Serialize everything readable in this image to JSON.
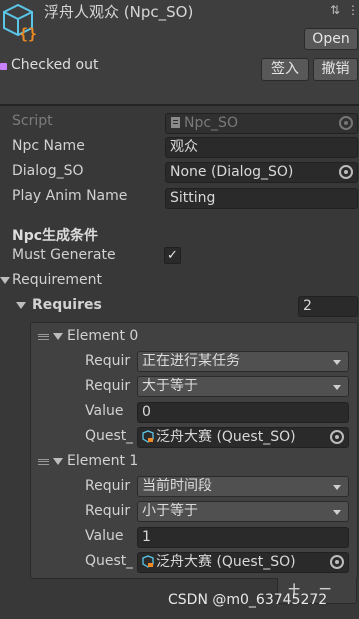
{
  "header": {
    "title": "浮舟人观众 (Npc_SO)",
    "open_button": "Open",
    "checked_out": "Checked out",
    "checkin_button": "签入",
    "undo_button": "撤销"
  },
  "fields": {
    "script_label": "Script",
    "script_value": "Npc_SO",
    "npc_name_label": "Npc Name",
    "npc_name_value": "观众",
    "dialog_label": "Dialog_SO",
    "dialog_value": "None (Dialog_SO)",
    "anim_label": "Play Anim Name",
    "anim_value": "Sitting",
    "section_header": "Npc生成条件",
    "must_generate_label": "Must Generate",
    "must_generate_checked": true,
    "requirement_label": "Requirement",
    "requires_label": "Requires",
    "requires_count": "2"
  },
  "elements": [
    {
      "title": "Element 0",
      "req_label_1": "Requir",
      "req_value_1": "正在进行某任务",
      "req_label_2": "Requir",
      "req_value_2": "大于等于",
      "value_label": "Value",
      "value": "0",
      "quest_label": "Quest_",
      "quest_value": "泛舟大赛 (Quest_SO)"
    },
    {
      "title": "Element 1",
      "req_label_1": "Requir",
      "req_value_1": "当前时间段",
      "req_label_2": "Requir",
      "req_value_2": "小于等于",
      "value_label": "Value",
      "value": "1",
      "quest_label": "Quest_",
      "quest_value": "泛舟大赛 (Quest_SO)"
    }
  ],
  "list_footer": {
    "add": "+",
    "remove": "−"
  },
  "watermark": "CSDN @m0_63745272",
  "colors": {
    "accent_checked": "#c882ff",
    "icon_blue": "#5bc6e8",
    "icon_orange": "#f08a24"
  }
}
